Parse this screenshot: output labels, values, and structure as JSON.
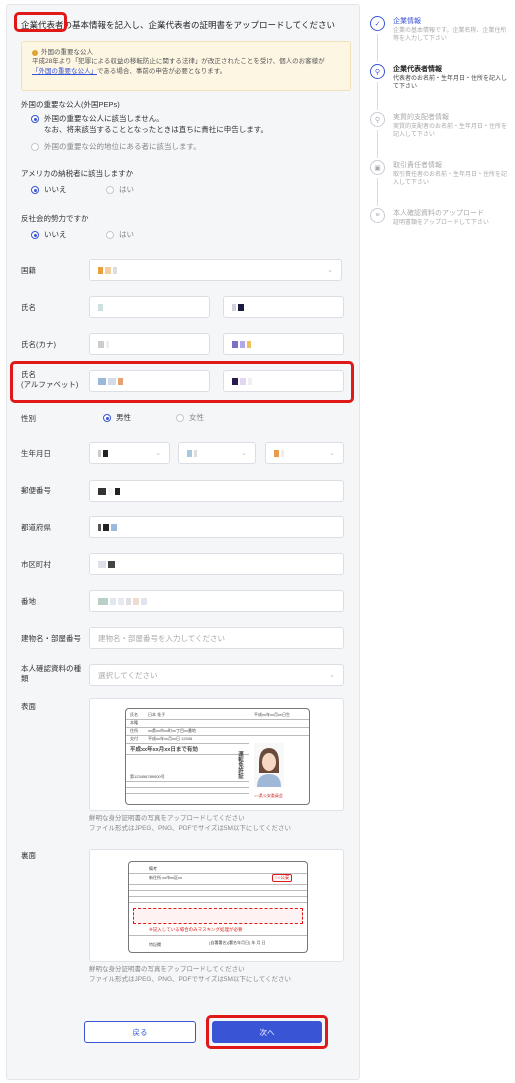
{
  "intro": {
    "highlight": "企業代表者",
    "text": "の基本情報を記入し、企業代表者の証明書をアップロードしてください"
  },
  "notice": {
    "title": "外国の重要な公人",
    "line1": "平成28年より「犯罪による収益の移転防止に関する法律」が改正されたことを受け、個人のお客様が",
    "link": "「外国の重要な公人」",
    "line2_rest": "である場合、事前の申告が必要となります。"
  },
  "peps": {
    "label": "外国の重要な公人(外国PEPs)",
    "option1": "外国の重要な公人に該当しません。",
    "option1_sub": "なお、将来該当することとなったときは直ちに貴社に申告します。",
    "option2": "外国の重要な公的地位にある者に該当します。"
  },
  "us_tax": {
    "label": "アメリカの納税者に該当しますか",
    "no": "いいえ",
    "yes": "はい"
  },
  "antisocial": {
    "label": "反社会的勢力ですか",
    "no": "いいえ",
    "yes": "はい"
  },
  "form": {
    "nationality": "国籍",
    "name": "氏名",
    "name_kana": "氏名(カナ)",
    "name_alpha_1": "氏名",
    "name_alpha_2": "(アルファベット)",
    "gender": "性別",
    "male": "男性",
    "female": "女性",
    "birthdate": "生年月日",
    "postal": "郵便番号",
    "prefecture": "都道府県",
    "city": "市区町村",
    "address": "番地",
    "building": "建物名・部屋番号",
    "building_placeholder": "建物名・部屋番号を入力してください",
    "id_type_1": "本人確認資料の種",
    "id_type_2": "類",
    "id_type_placeholder": "選択してください",
    "front": "表面",
    "back": "裏面",
    "upload_hint_1": "鮮明な身分証明書の写真をアップロードしてください",
    "upload_hint_2": "ファイル形式はJPEG、PNG、PDFでサイズは5M以下にしてください"
  },
  "card_front": {
    "name_label": "氏名",
    "name": "日本 花子",
    "birth": "平成xx年xx月xx日生",
    "honseki": "本籍",
    "jusho": "住所",
    "address": "xx県xx市xx町xx丁目xx番地",
    "koufu": "交付",
    "issued": "平成xx年xx月xx日 12345",
    "valid": "平成xx年xx月xx日まで有効",
    "number": "第123456789000号",
    "side": "運転免許証",
    "pref": "○○県公安委員会"
  },
  "card_back": {
    "remarks": "備考",
    "new_address": "新住所 xx市xx区xx",
    "stamp": "○○公安",
    "note": "※記入している場合のみマスキング処理が必要",
    "donor": "特記欄",
    "sign": "(自署署名)(署名年月日) 年 月 日"
  },
  "buttons": {
    "back": "戻る",
    "next": "次へ"
  },
  "steps": [
    {
      "title": "企業情報",
      "desc": "企業の基本情報です。企業名称、企業住所等を入力して下さい",
      "state": "done",
      "icon": "check-icon",
      "glyph": "✓"
    },
    {
      "title": "企業代表者情報",
      "desc": "代表者のお名前・生年月日・住所を記入して下さい",
      "state": "current",
      "icon": "person-icon",
      "glyph": "⚲"
    },
    {
      "title": "実質的支配者情報",
      "desc": "実質的支配者のお名前・生年月日・住所を記入して下さい",
      "state": "todo",
      "icon": "person-icon",
      "glyph": "⚲"
    },
    {
      "title": "取引責任者情報",
      "desc": "取引責任者のお名前・生年月日・住所を記入して下さい",
      "state": "todo",
      "icon": "briefcase-icon",
      "glyph": "▣"
    },
    {
      "title": "本人確認資料のアップロード",
      "desc": "証明書類をアップロードして下さい",
      "state": "todo",
      "icon": "document-icon",
      "glyph": "≡"
    }
  ],
  "colors": {
    "accent": "#3a54d6",
    "highlight_red": "#e01818",
    "notice_bg": "#fdf6e3"
  }
}
